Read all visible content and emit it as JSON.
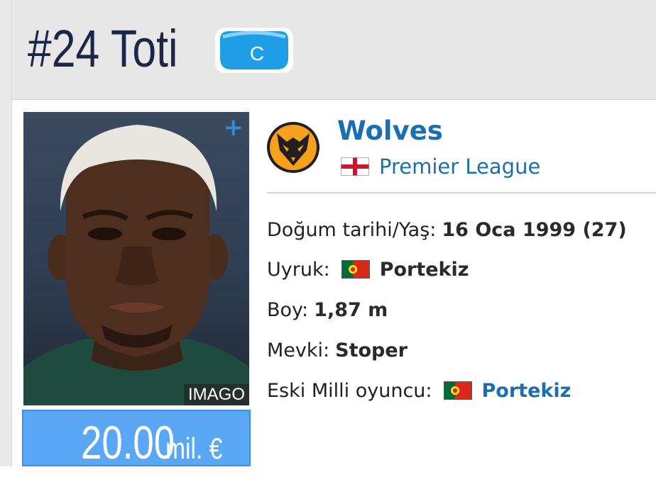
{
  "header": {
    "title": "#24 Toti",
    "captain_badge": "C"
  },
  "photo": {
    "credit": "IMAGO",
    "add_icon": "plus-icon"
  },
  "market_value": {
    "amount": "20.00",
    "unit": "mil. €"
  },
  "club": {
    "name": "Wolves",
    "league": "Premier League",
    "league_flag": "england-flag-icon",
    "logo": "wolves-crest-icon"
  },
  "details": [
    {
      "label": "Doğum tarihi/Yaş:",
      "value": "16 Oca 1999 (27)"
    },
    {
      "label": "Uyruk:",
      "value": "Portekiz",
      "flag": "portugal-flag-icon"
    },
    {
      "label": "Boy:",
      "value": "1,87 m"
    },
    {
      "label": "Mevki:",
      "value": "Stoper"
    },
    {
      "label": "Eski Milli oyuncu:",
      "value": "Portekiz",
      "flag": "portugal-flag-icon"
    }
  ],
  "colors": {
    "title": "#1a2746",
    "link": "#1b6fb0",
    "market_value_bg": "#5aa8f5",
    "captain_badge": "#1e9ee6"
  }
}
